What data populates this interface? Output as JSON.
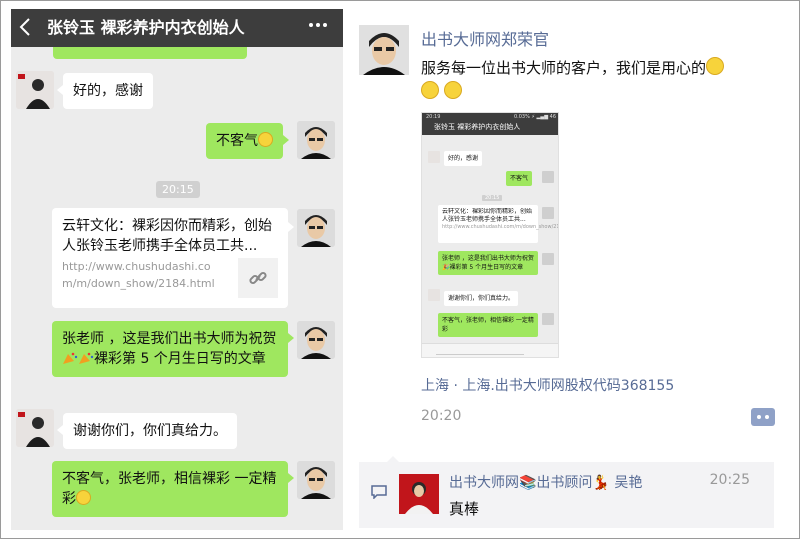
{
  "chat": {
    "title": "张铃玉 裸彩养护内衣创始人",
    "back_icon": "chevron-left-icon",
    "more_icon": "more-dots-icon",
    "messages": [
      {
        "from": "other",
        "text": "好的，感谢"
      },
      {
        "from": "me",
        "text": "不客气"
      },
      {
        "type": "time",
        "text": "20:15"
      },
      {
        "from": "me",
        "type": "link",
        "title": "云轩文化：裸彩因你而精彩，创始人张铃玉老师携手全体员工共...",
        "url": "http://www.chushudashi.com/m/down_show/2184.html"
      },
      {
        "from": "me",
        "text_a": "张老师 ，这是我们出书大师为祝贺",
        "text_b": "裸彩第 5 个月生日写的文章"
      },
      {
        "from": "other",
        "text": "谢谢你们，你们真给力。"
      },
      {
        "from": "me",
        "text": "不客气，张老师，相信裸彩 一定精彩"
      }
    ]
  },
  "post": {
    "author": "出书大师网郑荣官",
    "text": "服务每一位出书大师的客户，我们是用心的",
    "location": "上海 · 上海.出书大师网股权代码368155",
    "time": "20:20",
    "comment": {
      "name": "出书大师网📚出书顾问💃 吴艳",
      "time": "20:25",
      "text": "真棒"
    }
  },
  "thumbnail": {
    "status_time": "20:19",
    "status_right": "0.03% ⚡ ▂▄▆ 46",
    "title": "张铃玉 裸彩养护内衣创始人",
    "msg1": "好的，感谢",
    "msg2": "不客气",
    "time_pill": "20:15",
    "card_title": "云轩文化：裸彩因你而精彩，创始人张铃玉老师携手全体员工共...",
    "card_url": "http://www.chushudashi.com/m/down_show/2184.html",
    "msg3": "张老师 ，这是我们出书大师为祝贺🎉裸彩第 5 个月生日写的文章",
    "msg4": "谢谢你们，你们真给力。",
    "msg5": "不客气，张老师，相信裸彩 一定精彩"
  },
  "colors": {
    "header_bg": "#3d3d3d",
    "chat_bg": "#ececec",
    "green_bubble": "#9fe75f",
    "link_blue": "#576b95"
  }
}
